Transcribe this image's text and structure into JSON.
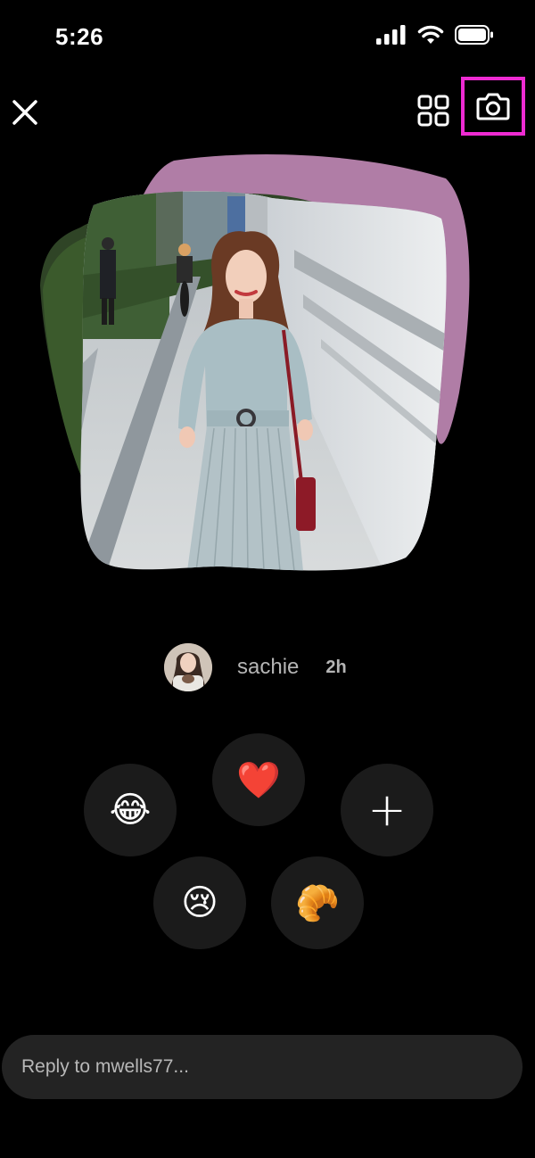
{
  "status_bar": {
    "time": "5:26"
  },
  "header": {
    "close_icon": "close-icon",
    "grid_icon": "grid-icon",
    "camera_icon": "camera-icon",
    "highlight_color": "#ee2bd2"
  },
  "post": {
    "background_shape_color": "#b07da6",
    "author": "sachie",
    "time": "2h"
  },
  "reactions": [
    {
      "name": "laughing",
      "emoji": "😂"
    },
    {
      "name": "heart",
      "emoji": "❤️"
    },
    {
      "name": "add",
      "emoji": "+"
    },
    {
      "name": "crying",
      "emoji": "😢"
    },
    {
      "name": "croissant",
      "emoji": "🥐"
    }
  ],
  "reply": {
    "placeholder": "Reply to mwells77..."
  }
}
